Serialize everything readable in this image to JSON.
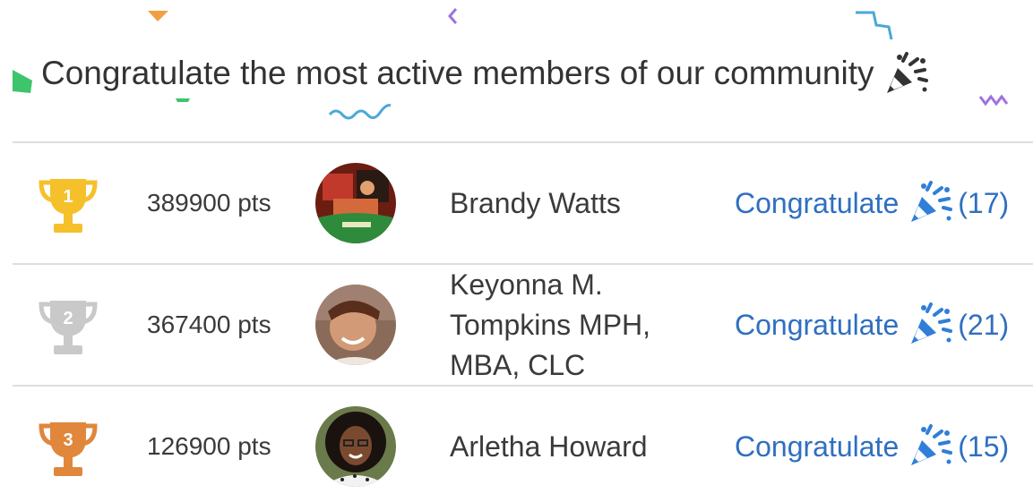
{
  "header": {
    "title": "Congratulate the most active members of our community",
    "title_icon": "party-popper-icon"
  },
  "colors": {
    "link": "#2f6fc0",
    "text": "#3a3a3a",
    "gold": "#f5c02a",
    "silver": "#c9c9c9",
    "bronze": "#e0873b",
    "divider": "#dedede"
  },
  "members": [
    {
      "rank": "1",
      "trophy": "gold-trophy-icon",
      "points": "389900 pts",
      "name": "Brandy Watts",
      "congratulate_label": "Congratulate",
      "congratulate_count": "(17)"
    },
    {
      "rank": "2",
      "trophy": "silver-trophy-icon",
      "points": "367400 pts",
      "name": "Keyonna M. Tompkins MPH, MBA, CLC",
      "congratulate_label": "Congratulate",
      "congratulate_count": "(21)"
    },
    {
      "rank": "3",
      "trophy": "bronze-trophy-icon",
      "points": "126900 pts",
      "name": "Arletha Howard",
      "congratulate_label": "Congratulate",
      "congratulate_count": "(15)"
    }
  ]
}
